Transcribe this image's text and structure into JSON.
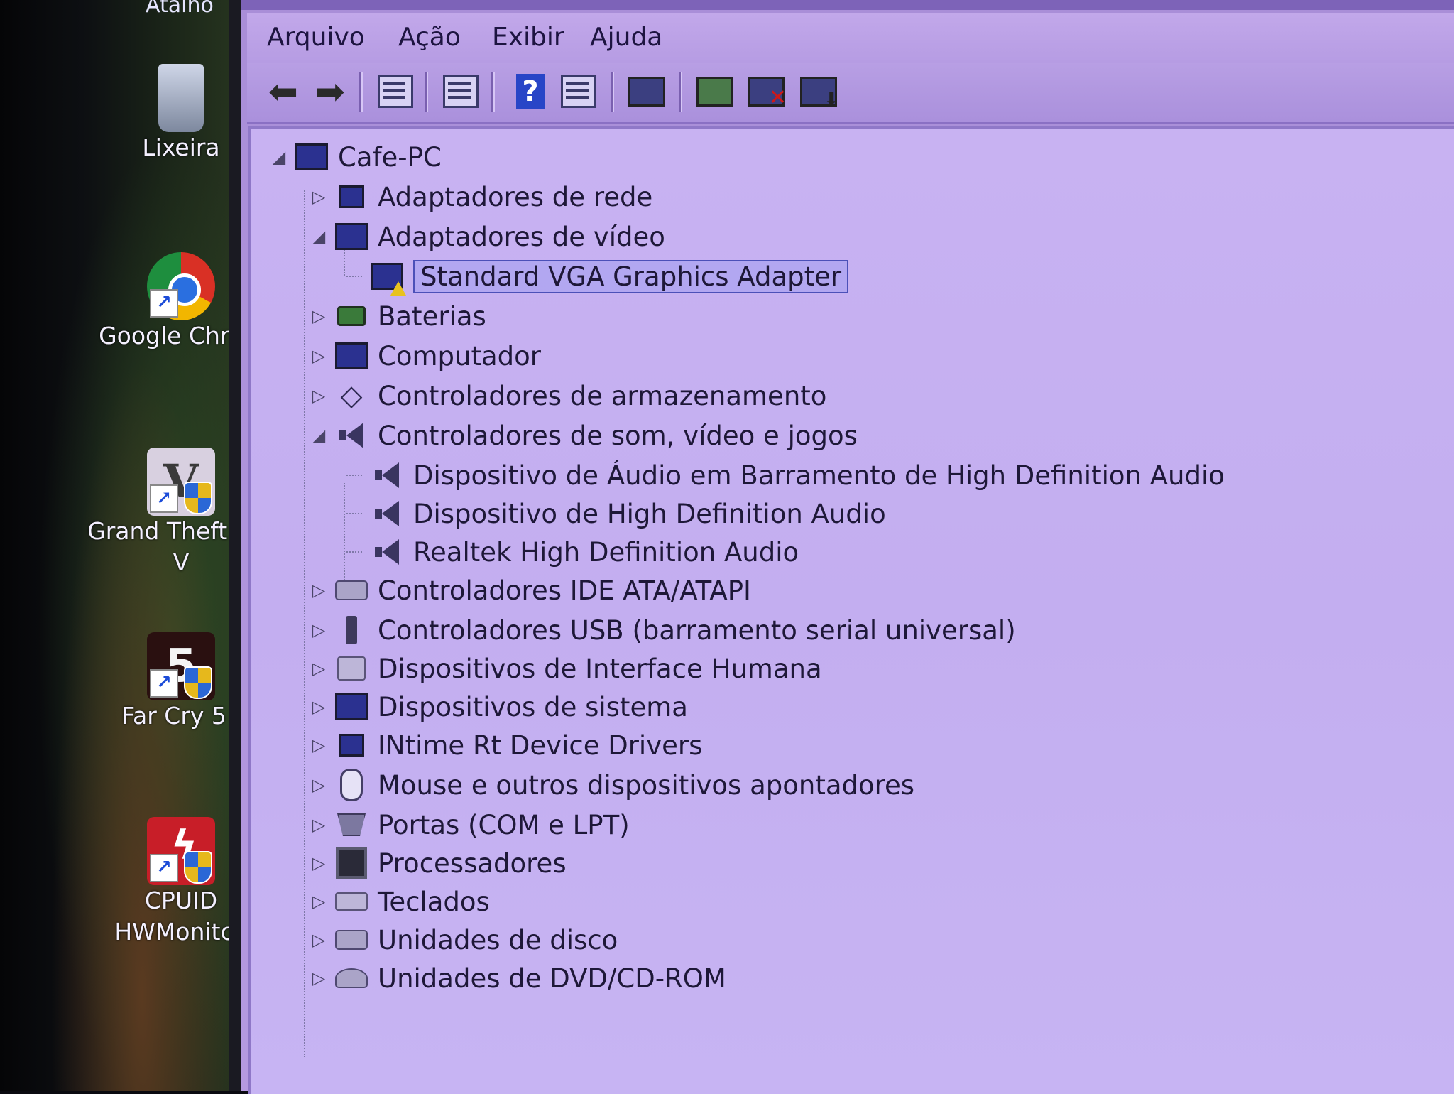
{
  "desktop": {
    "cut_top_label": "Atalho",
    "icons": [
      {
        "name": "Lixeira",
        "lines": [
          "Lixeira"
        ]
      },
      {
        "name": "Google Chrome",
        "lines": [
          "Google Chrc"
        ]
      },
      {
        "name": "Grand Theft Auto V",
        "lines": [
          "Grand Theft /",
          "V"
        ]
      },
      {
        "name": "Far Cry 5",
        "lines": [
          "Far Cry 5"
        ]
      },
      {
        "name": "CPUID HWMonitor",
        "lines": [
          "CPUID",
          "HWMonitc"
        ]
      }
    ]
  },
  "window": {
    "menu": [
      "Arquivo",
      "Ação",
      "Exibir",
      "Ajuda"
    ],
    "toolbar_icons": [
      "back-arrow-icon",
      "forward-arrow-icon",
      "console-tree-icon",
      "properties-icon",
      "help-icon",
      "action-pane-icon",
      "scan-hardware-icon",
      "update-driver-icon",
      "uninstall-device-icon",
      "disable-device-icon"
    ],
    "tree": {
      "root": "Cafe-PC",
      "items": [
        {
          "label": "Adaptadores de rede",
          "icon": "network-adapter-icon",
          "expanded": false
        },
        {
          "label": "Adaptadores de vídeo",
          "icon": "display-adapter-icon",
          "expanded": true,
          "children": [
            {
              "label": "Standard VGA Graphics Adapter",
              "icon": "display-warning-icon",
              "selected": true
            }
          ]
        },
        {
          "label": "Baterias",
          "icon": "battery-icon",
          "expanded": false
        },
        {
          "label": "Computador",
          "icon": "computer-icon",
          "expanded": false
        },
        {
          "label": "Controladores de armazenamento",
          "icon": "storage-controller-icon",
          "expanded": false
        },
        {
          "label": "Controladores de som, vídeo e jogos",
          "icon": "speaker-icon",
          "expanded": true,
          "children": [
            {
              "label": "Dispositivo de Áudio em Barramento de High Definition Audio",
              "icon": "speaker-icon"
            },
            {
              "label": "Dispositivo de High Definition Audio",
              "icon": "speaker-icon"
            },
            {
              "label": "Realtek High Definition Audio",
              "icon": "speaker-icon"
            }
          ]
        },
        {
          "label": "Controladores IDE ATA/ATAPI",
          "icon": "ide-controller-icon",
          "expanded": false
        },
        {
          "label": "Controladores USB (barramento serial universal)",
          "icon": "usb-icon",
          "expanded": false
        },
        {
          "label": "Dispositivos de Interface Humana",
          "icon": "hid-icon",
          "expanded": false
        },
        {
          "label": "Dispositivos de sistema",
          "icon": "system-device-icon",
          "expanded": false
        },
        {
          "label": "INtime Rt Device Drivers",
          "icon": "network-adapter-icon",
          "expanded": false
        },
        {
          "label": "Mouse e outros dispositivos apontadores",
          "icon": "mouse-icon",
          "expanded": false
        },
        {
          "label": "Portas (COM e LPT)",
          "icon": "port-icon",
          "expanded": false
        },
        {
          "label": "Processadores",
          "icon": "processor-icon",
          "expanded": false
        },
        {
          "label": "Teclados",
          "icon": "keyboard-icon",
          "expanded": false
        },
        {
          "label": "Unidades de disco",
          "icon": "disk-drive-icon",
          "expanded": false
        },
        {
          "label": "Unidades de DVD/CD-ROM",
          "icon": "dvd-drive-icon",
          "expanded": false
        }
      ]
    }
  }
}
